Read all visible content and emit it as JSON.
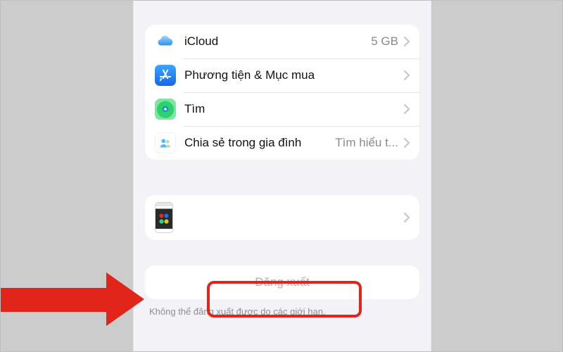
{
  "rows": [
    {
      "label": "iCloud",
      "detail": "5 GB"
    },
    {
      "label": "Phương tiện & Mục mua"
    },
    {
      "label": "Tìm"
    },
    {
      "label": "Chia sẻ trong gia đình",
      "detail": "Tìm hiểu t..."
    }
  ],
  "device": {
    "label": ""
  },
  "signout": {
    "label": "Đăng xuất",
    "footnote": "Không thể đăng xuất được do các giới hạn."
  },
  "colors": {
    "highlight": "#e1251b",
    "background": "#f2f2f7",
    "group": "#ffffff"
  }
}
